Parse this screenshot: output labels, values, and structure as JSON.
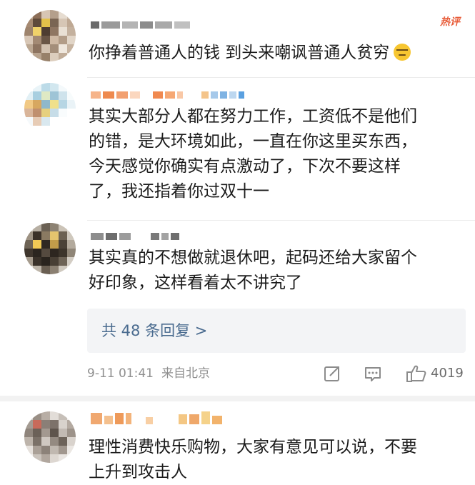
{
  "comments": [
    {
      "username": "",
      "text": "你挣着普通人的钱 到头来嘲讽普通人贫穷",
      "badge": "热评",
      "emoji": "sweat-smile-emoji",
      "colors": [
        "#b9a594",
        "#8a6b5a",
        "#d8c9b8",
        "#efe6db",
        "#a99582",
        "#6e5a4c"
      ]
    },
    {
      "username": "",
      "text_lines": [
        "其实大部分人都在努力工作，工资低不是他们",
        "的错，是大环境如此，一直在你这里买东西，",
        "今天感觉你确实有点激动了，下次不要这样",
        "了，我还指着你过双十一"
      ]
    },
    {
      "username": "",
      "text_lines": [
        "其实真的不想做就退休吧，起码还给大家留个",
        "好印象，这样看着太不讲究了"
      ]
    },
    {
      "username": "",
      "text_lines": [
        "理性消费快乐购物，大家有意见可以说，不要",
        "上升到攻击人"
      ]
    }
  ],
  "replies": {
    "label": "共 48 条回复 >"
  },
  "meta": {
    "time": "9-11 01:41",
    "location": "来自北京",
    "like_count": "4019"
  },
  "icons": {
    "share": "share-icon",
    "comment": "comment-icon",
    "like": "thumbs-up-icon"
  },
  "accent": {
    "hot": "#e85d3a",
    "link": "#4a6b8f",
    "meta": "#8f8f8f"
  }
}
